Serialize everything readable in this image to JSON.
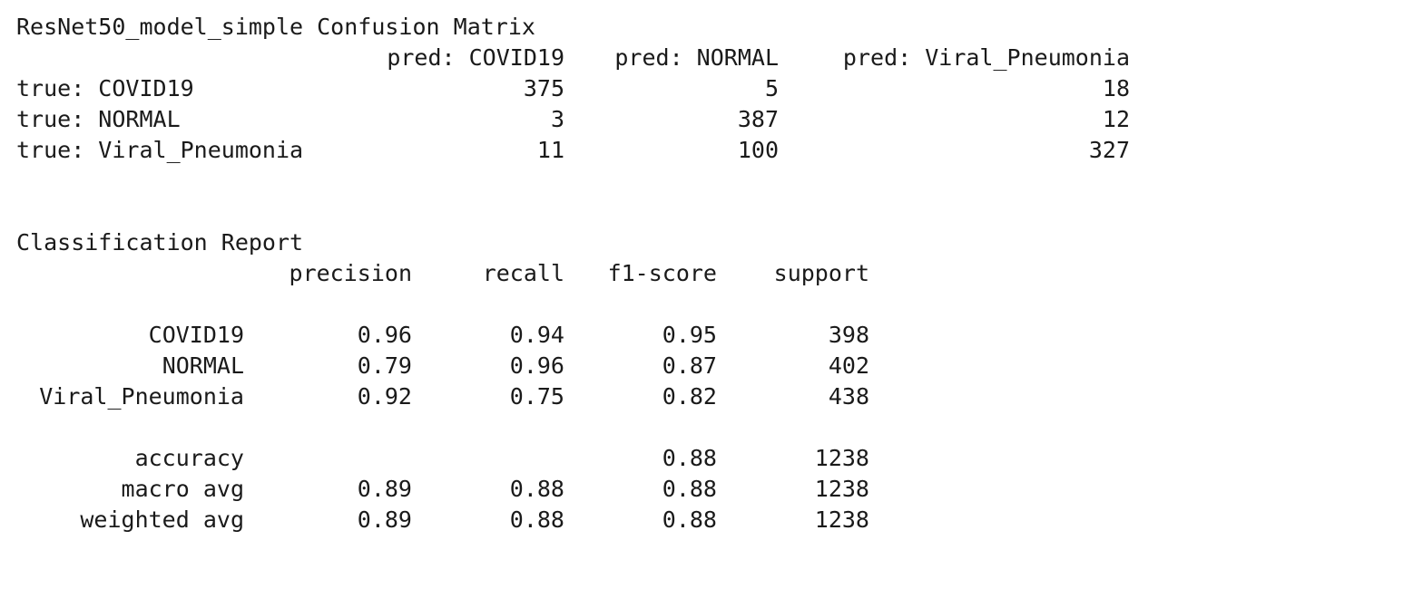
{
  "confusion": {
    "title": "ResNet50_model_simple Confusion Matrix",
    "col_headers": [
      "pred: COVID19",
      "pred: NORMAL",
      "pred: Viral_Pneumonia"
    ],
    "rows": [
      {
        "label": "true: COVID19",
        "values": [
          "375",
          "5",
          "18"
        ]
      },
      {
        "label": "true: NORMAL",
        "values": [
          "3",
          "387",
          "12"
        ]
      },
      {
        "label": "true: Viral_Pneumonia",
        "values": [
          "11",
          "100",
          "327"
        ]
      }
    ]
  },
  "report": {
    "title": "Classification Report",
    "headers": [
      "precision",
      "recall",
      "f1-score",
      "support"
    ],
    "class_rows": [
      {
        "label": "COVID19",
        "values": [
          "0.96",
          "0.94",
          "0.95",
          "398"
        ]
      },
      {
        "label": "NORMAL",
        "values": [
          "0.79",
          "0.96",
          "0.87",
          "402"
        ]
      },
      {
        "label": "Viral_Pneumonia",
        "values": [
          "0.92",
          "0.75",
          "0.82",
          "438"
        ]
      }
    ],
    "summary_rows": [
      {
        "label": "accuracy",
        "values": [
          "",
          "",
          "0.88",
          "1238"
        ]
      },
      {
        "label": "macro avg",
        "values": [
          "0.89",
          "0.88",
          "0.88",
          "1238"
        ]
      },
      {
        "label": "weighted avg",
        "values": [
          "0.89",
          "0.88",
          "0.88",
          "1238"
        ]
      }
    ]
  }
}
